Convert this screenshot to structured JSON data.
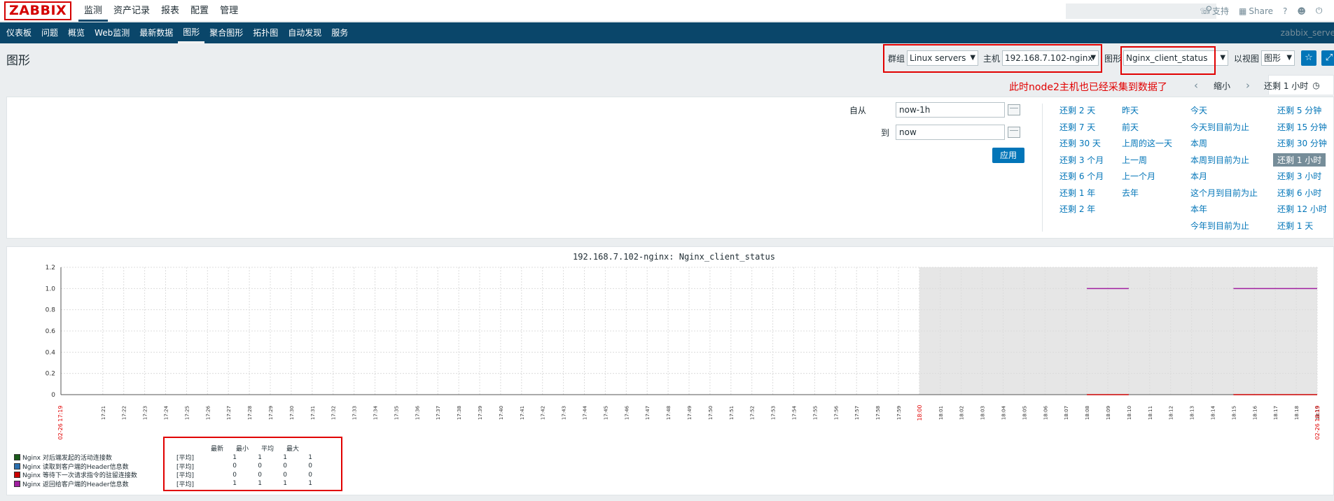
{
  "logo": "ZABBIX",
  "topnav": [
    "监测",
    "资产记录",
    "报表",
    "配置",
    "管理"
  ],
  "toplinks": {
    "support": "支持",
    "share": "Share",
    "help": "?",
    "user": "👤",
    "power": "⏻"
  },
  "subnav": [
    "仪表板",
    "问题",
    "概览",
    "Web监测",
    "最新数据",
    "图形",
    "聚合图形",
    "拓扑图",
    "自动发现",
    "服务"
  ],
  "server_name": "zabbix_serve",
  "page_title": "图形",
  "filters": {
    "group_label": "群组",
    "group_value": "Linux servers",
    "host_label": "主机",
    "host_value": "192.168.7.102-nginx",
    "graph_label": "图形",
    "graph_value": "Nginx_client_status",
    "view_label": "以视图",
    "view_value": "图形"
  },
  "annotation": "此时node2主机也已经采集到数据了",
  "timenav": {
    "zoom_out": "缩小",
    "active_tab": "还剩 1 小时"
  },
  "time_form": {
    "from_label": "自从",
    "from_value": "now-1h",
    "to_label": "到",
    "to_value": "now",
    "apply": "应用"
  },
  "quick_ranges": [
    [
      "还剩 2 天",
      "还剩 7 天",
      "还剩 30 天",
      "还剩 3 个月",
      "还剩 6 个月",
      "还剩 1 年",
      "还剩 2 年"
    ],
    [
      "昨天",
      "前天",
      "上周的这一天",
      "上一周",
      "上一个月",
      "去年"
    ],
    [
      "今天",
      "今天到目前为止",
      "本周",
      "本周到目前为止",
      "本月",
      "这个月到目前为止",
      "本年",
      "今年到目前为止"
    ],
    [
      "还剩 5 分钟",
      "还剩 15 分钟",
      "还剩 30 分钟",
      "还剩 1 小时",
      "还剩 3 小时",
      "还剩 6 小时",
      "还剩 12 小时",
      "还剩 1 天"
    ]
  ],
  "chart_data": {
    "type": "line",
    "title": "192.168.7.102-nginx: Nginx_client_status",
    "ylim": [
      0,
      1.2
    ],
    "yticks": [
      "1.2",
      "1.0",
      "0.8",
      "0.6",
      "0.4",
      "0.2",
      "0"
    ],
    "x_start_label": "02-26 17:19",
    "x_end_label": "02-26 18:19",
    "x_ticks": [
      "17:21",
      "17:22",
      "17:23",
      "17:24",
      "17:25",
      "17:26",
      "17:27",
      "17:28",
      "17:29",
      "17:30",
      "17:31",
      "17:32",
      "17:33",
      "17:34",
      "17:35",
      "17:36",
      "17:37",
      "17:38",
      "17:39",
      "17:40",
      "17:41",
      "17:42",
      "17:43",
      "17:44",
      "17:45",
      "17:46",
      "17:47",
      "17:48",
      "17:49",
      "17:50",
      "17:51",
      "17:52",
      "17:53",
      "17:54",
      "17:55",
      "17:56",
      "17:57",
      "17:58",
      "17:59",
      "18:00",
      "18:01",
      "18:02",
      "18:03",
      "18:04",
      "18:05",
      "18:06",
      "18:07",
      "18:08",
      "18:09",
      "18:10",
      "18:11",
      "18:12",
      "18:13",
      "18:14",
      "18:15",
      "18:16",
      "18:17",
      "18:18",
      "18:19"
    ],
    "highlight_tick": "18:00",
    "series": [
      {
        "name": "Nginx 对后端发起的活动连接数",
        "color": "#1a5b1a",
        "agg": "[平均]",
        "last": "1",
        "min": "1",
        "avg": "1",
        "max": "1"
      },
      {
        "name": "Nginx 读取到客户端的Header信息数",
        "color": "#2b6fae",
        "agg": "[平均]",
        "last": "0",
        "min": "0",
        "avg": "0",
        "max": "0"
      },
      {
        "name": "Nginx 等待下一次请求指令的驻留连接数",
        "color": "#cc0000",
        "agg": "[平均]",
        "last": "0",
        "min": "0",
        "avg": "0",
        "max": "0"
      },
      {
        "name": "Nginx 返回给客户端的Header信息数",
        "color": "#a020a0",
        "agg": "[平均]",
        "last": "1",
        "min": "1",
        "avg": "1",
        "max": "1"
      }
    ],
    "segments": [
      {
        "series": 3,
        "x0": "18:08",
        "x1": "18:10",
        "y": 1
      },
      {
        "series": 3,
        "x0": "18:15",
        "x1": "18:19",
        "y": 1
      },
      {
        "series": 2,
        "x0": "18:08",
        "x1": "18:10",
        "y": 0
      },
      {
        "series": 2,
        "x0": "18:15",
        "x1": "18:19",
        "y": 0
      }
    ],
    "legend_headers": [
      "最新",
      "最小",
      "平均",
      "最大"
    ]
  }
}
